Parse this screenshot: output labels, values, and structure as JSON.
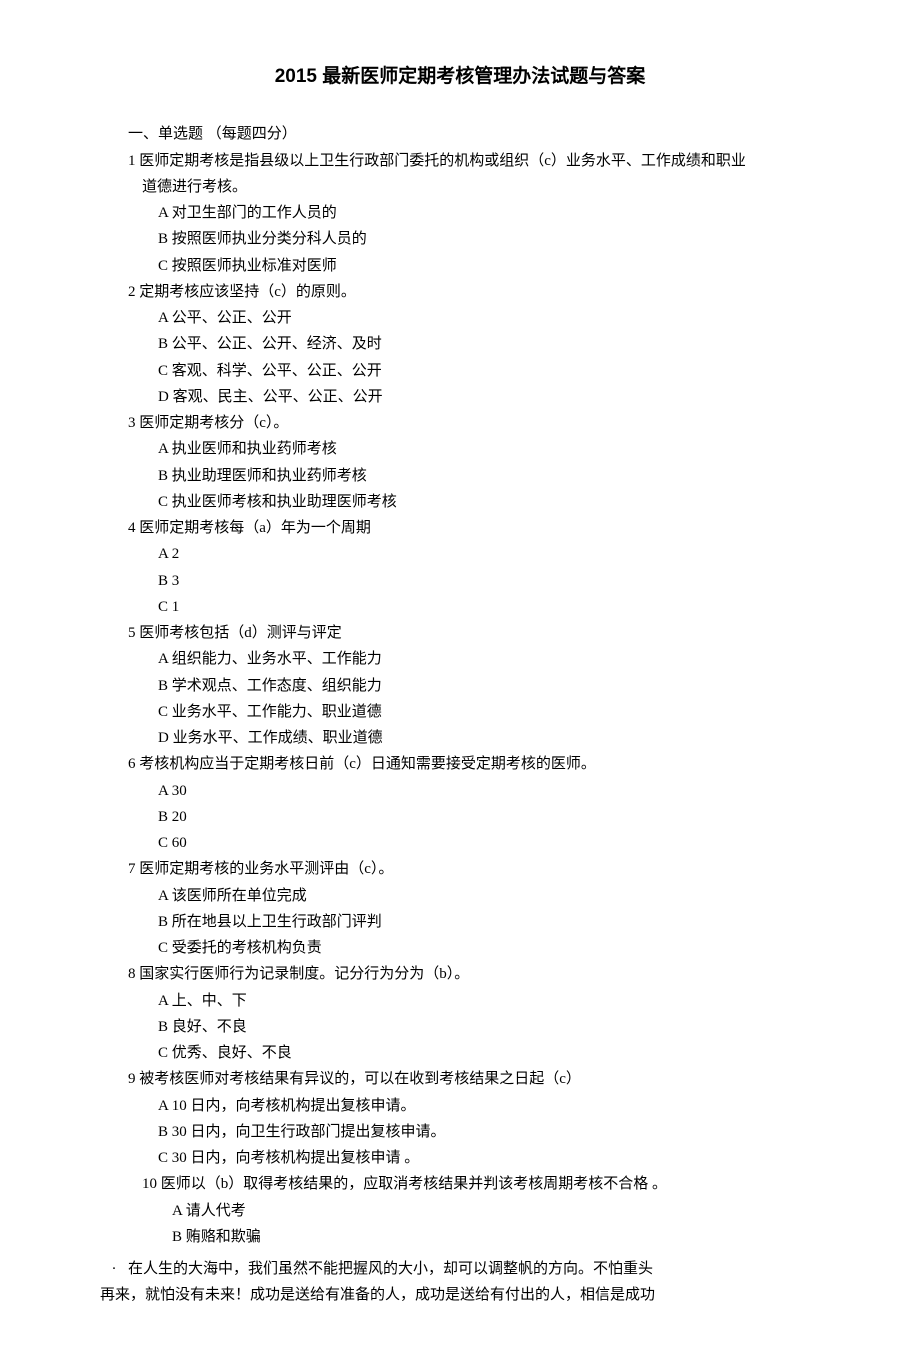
{
  "title": "2015 最新医师定期考核管理办法试题与答案",
  "sectionHeader": "一、单选题 （每题四分）",
  "q1": {
    "stem": "1 医师定期考核是指县级以上卫生行政部门委托的机构或组织（c）业务水平、工作成绩和职业",
    "stemCont": "道德进行考核。",
    "a": "A 对卫生部门的工作人员的",
    "b": "B 按照医师执业分类分科人员的",
    "c": "C 按照医师执业标准对医师"
  },
  "q2": {
    "stem": "2 定期考核应该坚持（c）的原则。",
    "a": "A 公平、公正、公开",
    "b": "B 公平、公正、公开、经济、及时",
    "c": "C 客观、科学、公平、公正、公开",
    "d": "D 客观、民主、公平、公正、公开"
  },
  "q3": {
    "stem": "3 医师定期考核分（c）。",
    "a": "A 执业医师和执业药师考核",
    "b": "B 执业助理医师和执业药师考核",
    "c": "C 执业医师考核和执业助理医师考核"
  },
  "q4": {
    "stem": "4 医师定期考核每（a）年为一个周期",
    "a": "A 2",
    "b": "B 3",
    "c": "C 1"
  },
  "q5": {
    "stem": "5 医师考核包括（d）测评与评定",
    "a": "A 组织能力、业务水平、工作能力",
    "b": "B 学术观点、工作态度、组织能力",
    "c": "C  业务水平、工作能力、职业道德",
    "d": "D  业务水平、工作成绩、职业道德"
  },
  "q6": {
    "stem": "6 考核机构应当于定期考核日前（c）日通知需要接受定期考核的医师。",
    "a": "A 30",
    "b": "B 20",
    "c": "C 60"
  },
  "q7": {
    "stem": "7 医师定期考核的业务水平测评由（c）。",
    "a": "A 该医师所在单位完成",
    "b": "B 所在地县以上卫生行政部门评判",
    "c": "C 受委托的考核机构负责"
  },
  "q8": {
    "stem": "8 国家实行医师行为记录制度。记分行为分为（b）。",
    "a": "A 上、中、下",
    "b": "B 良好、不良",
    "c": "C 优秀、良好、不良"
  },
  "q9": {
    "stem": "9 被考核医师对考核结果有异议的，可以在收到考核结果之日起（c）",
    "a": "A 10 日内，向考核机构提出复核申请。",
    "b": "B 30 日内，向卫生行政部门提出复核申请。",
    "c": "C 30 日内，向考核机构提出复核申请 。"
  },
  "q10": {
    "stem": "10 医师以（b）取得考核结果的，应取消考核结果并判该考核周期考核不合格 。",
    "a": "A 请人代考",
    "b": "B 贿赂和欺骗"
  },
  "footer": {
    "bullet": "·",
    "line1": "在人生的大海中，我们虽然不能把握风的大小，却可以调整帆的方向。不怕重头",
    "line2": "再来，就怕没有未来！成功是送给有准备的人，成功是送给有付出的人，相信是成功"
  }
}
